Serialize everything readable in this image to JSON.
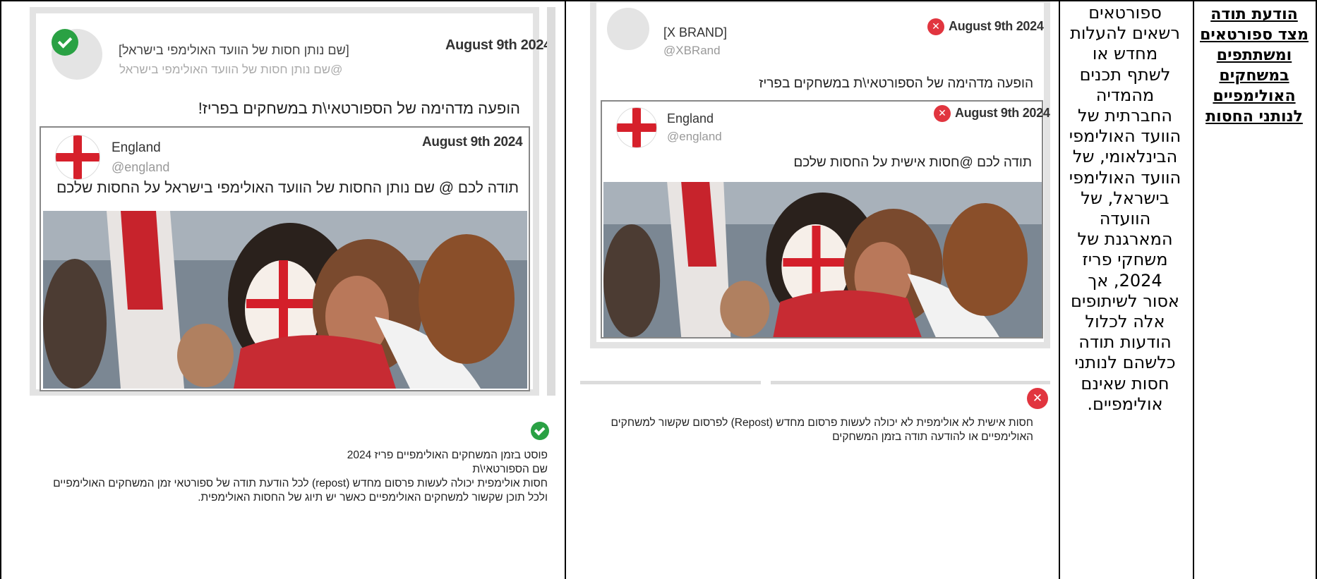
{
  "title_cell": "הודעת תודה מצד ספורטאים ומשתתפים במשחקים האולימפיים לנותני החסות",
  "description_cell": "ספורטאים רשאים להעלות מחדש או לשתף תכנים מהמדיה החברתית של הוועד האולימפי הבינלאומי, של הוועד האולימפי בישראל, של הוועדה המארגנת של משחקי פריז 2024, אך אסור לשיתופים אלה לכלול הודעות תודה כלשהם לנותני חסות שאינם אולימפיים.",
  "allowed_example": {
    "status_icon": "check-circle-icon",
    "outer_post": {
      "author_name": "[שם נותן חסות של הוועד האולימפי בישראל]",
      "author_handle": "@שם נותן חסות של הוועד האולימפי בישראל",
      "date": "August 9th 2024",
      "text": "הופעה מדהימה של הספורטאי\\ת במשחקים בפריז!"
    },
    "quoted_post": {
      "author_name": "England",
      "author_handle": "@england",
      "date": "August 9th 2024",
      "text": "תודה לכם @ שם נותן החסות של הוועד האולימפי בישראל על החסות שלכם"
    },
    "caption_lines": [
      "פוסט בזמן המשחקים האולימפיים פריז 2024",
      "שם הספורטאי\\ת",
      "חסות אולימפית יכולה לעשות פרסום מחדש (repost) לכל הודעת תודה של ספורטאי זמן המשחקים האולימפיים",
      "ולכל תוכן שקשור למשחקים האולימפיים כאשר יש תיוג של החסות האולימפית."
    ]
  },
  "disallowed_example": {
    "status_icon": "x-circle-icon",
    "outer_post": {
      "author_name": "[X BRAND]",
      "author_handle": "@XBRand",
      "date": "August 9th 2024",
      "text": "הופעה מדהימה של הספורטאי\\ת במשחקים בפריז"
    },
    "quoted_post": {
      "author_name": "England",
      "author_handle": "@england",
      "date": "August 9th 2024",
      "text": "תודה לכם @חסות אישית על החסות שלכם"
    },
    "caption_lines": [
      "חסות אישית לא אולימפית לא יכולה לעשות פרסום מחדש (Repost) לפרסום שקשור למשחקים",
      "האולימפיים או להודעה תודה בזמן המשחקים"
    ]
  },
  "colors": {
    "ok_green": "#2aa144",
    "bad_red": "#e1353f",
    "card_frame": "#e3e3e3",
    "england_red": "#d6202b"
  }
}
